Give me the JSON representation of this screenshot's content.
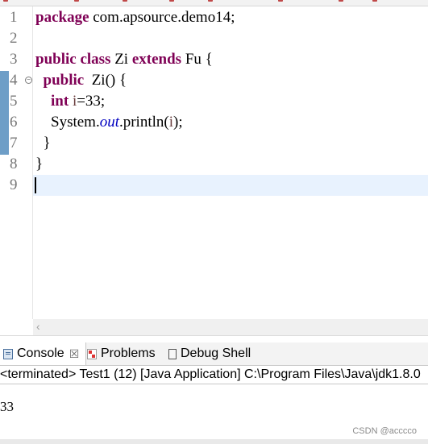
{
  "editor": {
    "lines": [
      {
        "num": "1",
        "tokens": [
          {
            "t": "package",
            "c": "kw"
          },
          {
            "t": " com.apsource.demo14;",
            "c": ""
          }
        ]
      },
      {
        "num": "2",
        "tokens": []
      },
      {
        "num": "3",
        "tokens": [
          {
            "t": "public",
            "c": "kw"
          },
          {
            "t": " ",
            "c": ""
          },
          {
            "t": "class",
            "c": "kw"
          },
          {
            "t": " Zi ",
            "c": ""
          },
          {
            "t": "extends",
            "c": "kw"
          },
          {
            "t": " Fu {",
            "c": ""
          }
        ]
      },
      {
        "num": "4",
        "fold": true,
        "tokens": [
          {
            "t": "  ",
            "c": ""
          },
          {
            "t": "public",
            "c": "kw"
          },
          {
            "t": "  Zi() {",
            "c": ""
          }
        ]
      },
      {
        "num": "5",
        "tokens": [
          {
            "t": "    ",
            "c": ""
          },
          {
            "t": "int",
            "c": "kw"
          },
          {
            "t": " ",
            "c": ""
          },
          {
            "t": "i",
            "c": "var"
          },
          {
            "t": "=33;",
            "c": ""
          }
        ]
      },
      {
        "num": "6",
        "tokens": [
          {
            "t": "    System.",
            "c": ""
          },
          {
            "t": "out",
            "c": "static"
          },
          {
            "t": ".println(",
            "c": ""
          },
          {
            "t": "i",
            "c": "var"
          },
          {
            "t": ");",
            "c": ""
          }
        ]
      },
      {
        "num": "7",
        "tokens": [
          {
            "t": "  }",
            "c": ""
          }
        ]
      },
      {
        "num": "8",
        "tokens": [
          {
            "t": "}",
            "c": ""
          }
        ]
      },
      {
        "num": "9",
        "tokens": []
      }
    ]
  },
  "console": {
    "tabs": [
      {
        "label": "Console",
        "icon": "console-icon",
        "active": true,
        "close": "☒"
      },
      {
        "label": "Problems",
        "icon": "problems-icon",
        "active": false
      },
      {
        "label": "Debug Shell",
        "icon": "debug-shell-icon",
        "active": false
      }
    ],
    "status": "<terminated> Test1 (12) [Java Application] C:\\Program Files\\Java\\jdk1.8.0",
    "output": "33"
  },
  "watermark": "CSDN @acccco",
  "colors": {
    "keyword": "#7f0055",
    "static_field": "#0000c0",
    "local_var": "#6a3e3e",
    "current_line": "#e8f2fe",
    "change_bar": "#6e9ec7"
  }
}
